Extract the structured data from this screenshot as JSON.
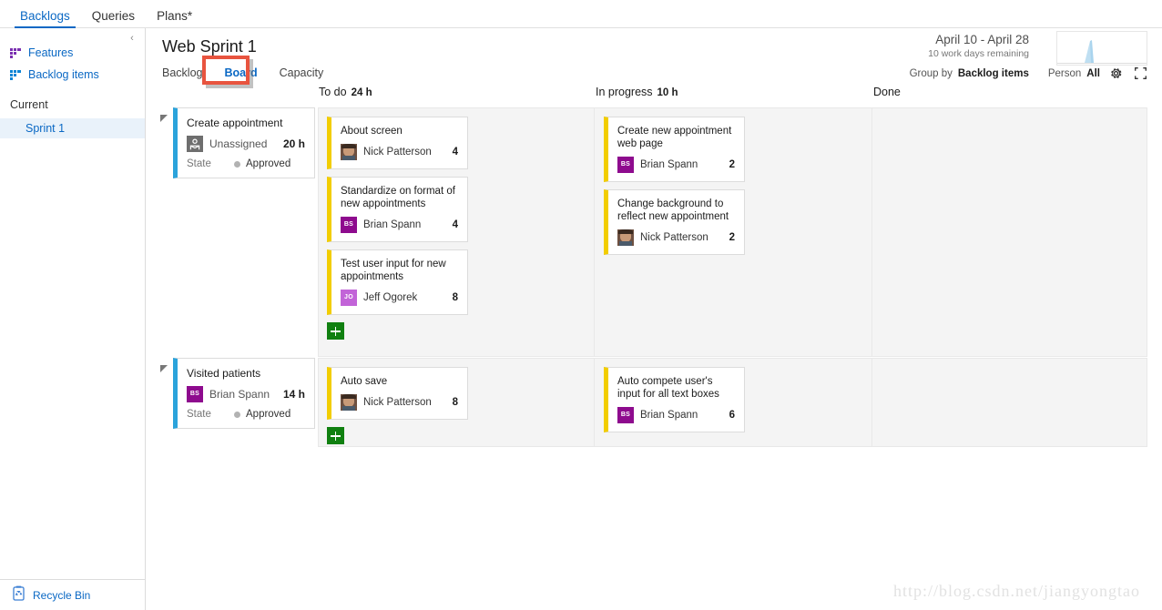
{
  "topnav": {
    "tabs": [
      {
        "label": "Backlogs",
        "active": true
      },
      {
        "label": "Queries",
        "active": false
      },
      {
        "label": "Plans*",
        "active": false
      }
    ]
  },
  "sidebar": {
    "collapse_glyph": "‹",
    "links": [
      {
        "label": "Features",
        "icon": "backlog-grid-icon",
        "color": "#7a2fb0"
      },
      {
        "label": "Backlog items",
        "icon": "backlog-grid-icon",
        "color": "#0a84d6"
      }
    ],
    "group_label": "Current",
    "items": [
      {
        "label": "Sprint 1",
        "selected": true
      }
    ],
    "footer": {
      "label": "Recycle Bin",
      "icon": "recycle-bin-icon"
    }
  },
  "header": {
    "title": "Web Sprint 1",
    "subtabs": [
      {
        "label": "Backlog",
        "active": false
      },
      {
        "label": "Board",
        "active": true
      },
      {
        "label": "Capacity",
        "active": false
      }
    ],
    "annotation_color": "#e8543f",
    "date_range": "April 10 - April 28",
    "days_remaining": "10 work days remaining",
    "burndown_alt": "sprint-burndown-sparkline"
  },
  "board_controls": {
    "group_by_label": "Group by",
    "group_by_value": "Backlog items",
    "person_label": "Person",
    "person_value": "All",
    "settings_icon": "gear-icon",
    "fullscreen_icon": "fullscreen-icon"
  },
  "board": {
    "columns": [
      {
        "name": "To do",
        "hours": "24 h"
      },
      {
        "name": "In progress",
        "hours": "10 h"
      },
      {
        "name": "Done",
        "hours": ""
      }
    ],
    "add_button_label": "+",
    "lanes": [
      {
        "backlog_item": {
          "title": "Create appointment",
          "assignee": "Unassigned",
          "avatar_type": "unassigned",
          "avatar_initials": "",
          "avatar_color": "#6e6e6e",
          "hours": "20 h",
          "state_label": "State",
          "state_value": "Approved"
        },
        "todo": [
          {
            "title": "About screen",
            "assignee": "Nick Patterson",
            "avatar_type": "photo",
            "avatar_initials": "",
            "avatar_color": "#8a6a55",
            "hours": "4"
          },
          {
            "title": "Standardize on format of new appointments",
            "assignee": "Brian Spann",
            "avatar_type": "initials",
            "avatar_initials": "BS",
            "avatar_color": "#8e0b8e",
            "hours": "4"
          },
          {
            "title": "Test user input for new appointments",
            "assignee": "Jeff Ogorek",
            "avatar_type": "initials",
            "avatar_initials": "JO",
            "avatar_color": "#c264d8",
            "hours": "8"
          }
        ],
        "inprogress": [
          {
            "title": "Create new appointment web page",
            "assignee": "Brian Spann",
            "avatar_type": "initials",
            "avatar_initials": "BS",
            "avatar_color": "#8e0b8e",
            "hours": "2"
          },
          {
            "title": "Change background to reflect new appointment",
            "assignee": "Nick Patterson",
            "avatar_type": "photo",
            "avatar_initials": "",
            "avatar_color": "#8a6a55",
            "hours": "2"
          }
        ],
        "done": []
      },
      {
        "backlog_item": {
          "title": "Visited patients",
          "assignee": "Brian Spann",
          "avatar_type": "initials",
          "avatar_initials": "BS",
          "avatar_color": "#8e0b8e",
          "hours": "14 h",
          "state_label": "State",
          "state_value": "Approved"
        },
        "todo": [
          {
            "title": "Auto save",
            "assignee": "Nick Patterson",
            "avatar_type": "photo",
            "avatar_initials": "",
            "avatar_color": "#8a6a55",
            "hours": "8"
          }
        ],
        "inprogress": [
          {
            "title": "Auto compete user's input for all text boxes",
            "assignee": "Brian Spann",
            "avatar_type": "initials",
            "avatar_initials": "BS",
            "avatar_color": "#8e0b8e",
            "hours": "6"
          }
        ],
        "done": []
      }
    ]
  },
  "watermark": "http://blog.csdn.net/jiangyongtao",
  "colors": {
    "accent_blue": "#0a68c4",
    "card_backlog_bar": "#2ba3db",
    "card_task_bar": "#f2cd00",
    "add_green": "#108010",
    "lane_bg": "#f4f4f4"
  }
}
